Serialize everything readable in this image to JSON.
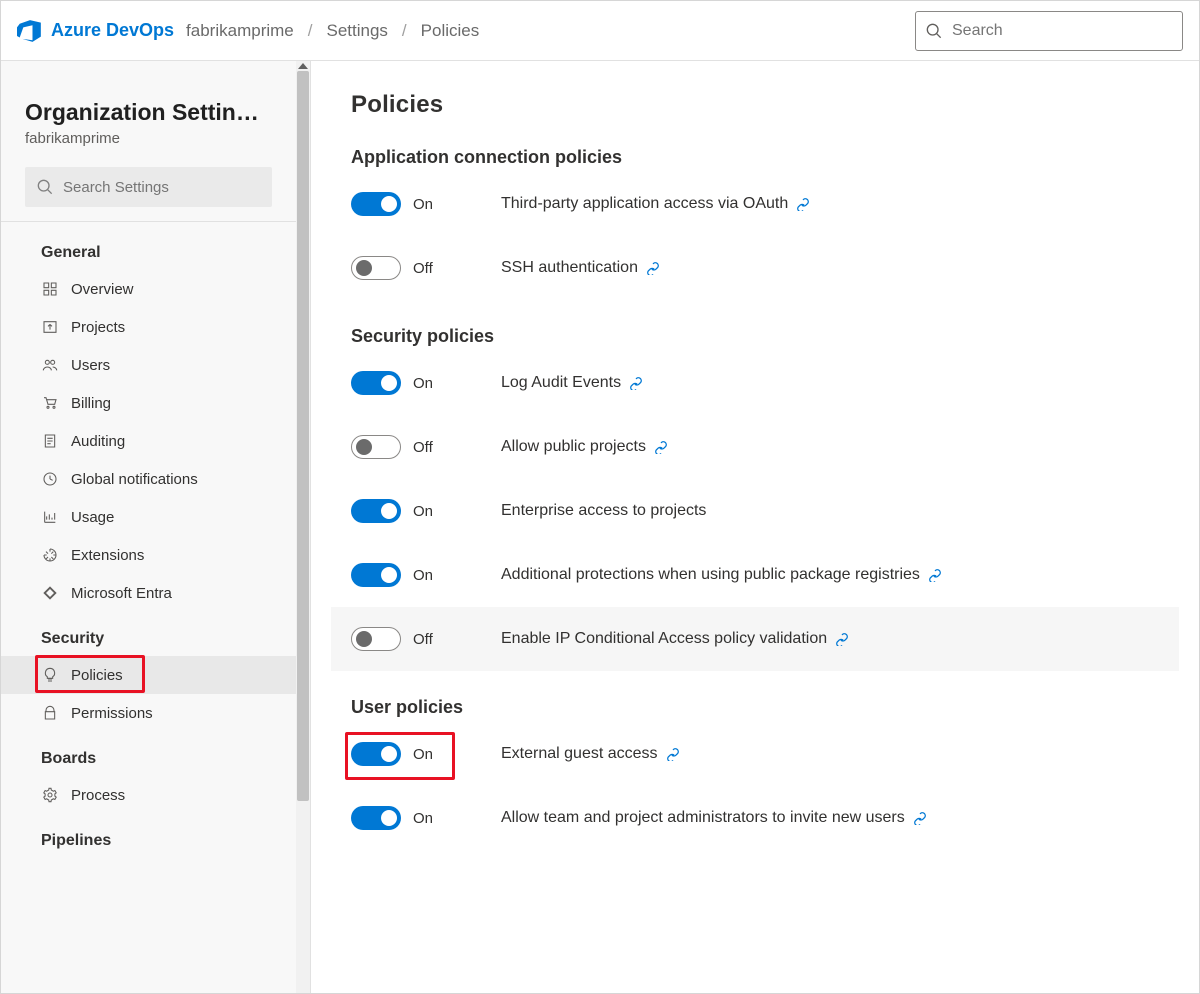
{
  "header": {
    "brand": "Azure DevOps",
    "crumbs": [
      "fabrikamprime",
      "Settings",
      "Policies"
    ],
    "search_placeholder": "Search"
  },
  "sidebar": {
    "title": "Organization Settin…",
    "subtitle": "fabrikamprime",
    "search_placeholder": "Search Settings",
    "groups": [
      {
        "label": "General",
        "items": [
          {
            "id": "overview",
            "label": "Overview",
            "icon": "grid-icon"
          },
          {
            "id": "projects",
            "label": "Projects",
            "icon": "upload-icon"
          },
          {
            "id": "users",
            "label": "Users",
            "icon": "people-icon"
          },
          {
            "id": "billing",
            "label": "Billing",
            "icon": "cart-icon"
          },
          {
            "id": "auditing",
            "label": "Auditing",
            "icon": "list-icon"
          },
          {
            "id": "global-notifications",
            "label": "Global notifications",
            "icon": "clock-icon"
          },
          {
            "id": "usage",
            "label": "Usage",
            "icon": "chart-icon"
          },
          {
            "id": "extensions",
            "label": "Extensions",
            "icon": "puzzle-icon"
          },
          {
            "id": "msentra",
            "label": "Microsoft Entra",
            "icon": "entra-icon"
          }
        ]
      },
      {
        "label": "Security",
        "items": [
          {
            "id": "policies",
            "label": "Policies",
            "icon": "bulb-icon",
            "active": true,
            "highlight": true
          },
          {
            "id": "permissions",
            "label": "Permissions",
            "icon": "lock-icon"
          }
        ]
      },
      {
        "label": "Boards",
        "items": [
          {
            "id": "process",
            "label": "Process",
            "icon": "gear-icon"
          }
        ]
      },
      {
        "label": "Pipelines",
        "items": []
      }
    ]
  },
  "main": {
    "title": "Policies",
    "sections": [
      {
        "title": "Application connection policies",
        "rows": [
          {
            "on": true,
            "state": "On",
            "label": "Third-party application access via OAuth",
            "link": true
          },
          {
            "on": false,
            "state": "Off",
            "label": "SSH authentication",
            "link": true
          }
        ]
      },
      {
        "title": "Security policies",
        "rows": [
          {
            "on": true,
            "state": "On",
            "label": "Log Audit Events",
            "link": true
          },
          {
            "on": false,
            "state": "Off",
            "label": "Allow public projects",
            "link": true
          },
          {
            "on": true,
            "state": "On",
            "label": "Enterprise access to projects",
            "link": false
          },
          {
            "on": true,
            "state": "On",
            "label": "Additional protections when using public package registries",
            "link": true
          },
          {
            "on": false,
            "state": "Off",
            "label": "Enable IP Conditional Access policy validation",
            "link": true,
            "hover": true
          }
        ]
      },
      {
        "title": "User policies",
        "rows": [
          {
            "on": true,
            "state": "On",
            "label": "External guest access",
            "link": true,
            "redbox": true
          },
          {
            "on": true,
            "state": "On",
            "label": "Allow team and project administrators to invite new users",
            "link": true
          }
        ]
      }
    ]
  }
}
